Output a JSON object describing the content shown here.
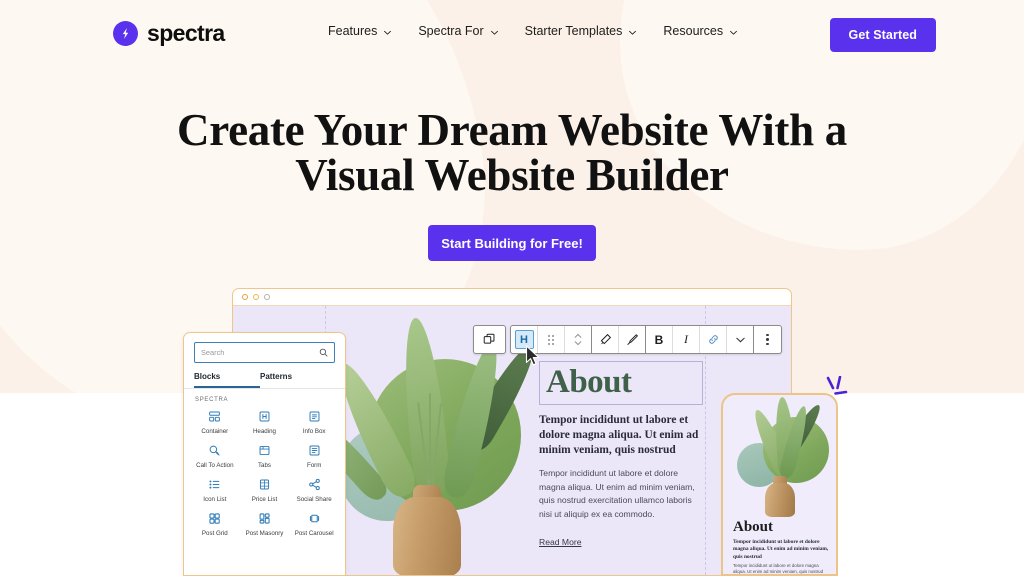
{
  "site": {
    "brand_name": "spectra",
    "brand_icon": "lightning-bolt-icon"
  },
  "header": {
    "nav_items": [
      {
        "label": "Features",
        "icon": "chevron-down-icon"
      },
      {
        "label": "Spectra For",
        "icon": "chevron-down-icon"
      },
      {
        "label": "Starter Templates",
        "icon": "chevron-down-icon"
      },
      {
        "label": "Resources",
        "icon": "chevron-down-icon"
      }
    ],
    "cta_label": "Get Started"
  },
  "hero": {
    "title_line1": "Create Your Dream Website With a",
    "title_line2": "Visual Website Builder",
    "cta_label": "Start Building for Free!"
  },
  "editor": {
    "inserter": {
      "search_placeholder": "Search",
      "search_icon": "search-icon",
      "tabs": [
        {
          "label": "Blocks",
          "active": true
        },
        {
          "label": "Patterns",
          "active": false
        }
      ],
      "section_label": "SPECTRA",
      "blocks": [
        {
          "label": "Container",
          "icon": "container-icon"
        },
        {
          "label": "Heading",
          "icon": "heading-icon"
        },
        {
          "label": "Info Box",
          "icon": "info-box-icon"
        },
        {
          "label": "Call To Action",
          "icon": "call-to-action-icon"
        },
        {
          "label": "Tabs",
          "icon": "tabs-icon"
        },
        {
          "label": "Form",
          "icon": "form-icon"
        },
        {
          "label": "Icon List",
          "icon": "icon-list-icon"
        },
        {
          "label": "Price List",
          "icon": "price-list-icon"
        },
        {
          "label": "Social Share",
          "icon": "social-share-icon"
        },
        {
          "label": "Post Grid",
          "icon": "post-grid-icon"
        },
        {
          "label": "Post Masonry",
          "icon": "post-masonry-icon"
        },
        {
          "label": "Post Carousel",
          "icon": "post-carousel-icon"
        }
      ]
    },
    "toolbar": {
      "copy_icon": "copy-blocks-icon",
      "block_type_label": "H",
      "drag_icon": "drag-handle-icon",
      "move_icon": "move-up-down-icon",
      "transform_icon": "transform-icon",
      "style_icon": "brush-icon",
      "bold_label": "B",
      "italic_label": "I",
      "link_icon": "link-icon",
      "more_formats_icon": "chevron-down-icon",
      "options_icon": "vertical-dots-icon"
    },
    "canvas": {
      "window_dots": [
        "close-dot",
        "minimize-dot",
        "maximize-dot"
      ],
      "heading": "About",
      "subheading": "Tempor incididunt ut labore et dolore magna aliqua. Ut enim ad minim veniam, quis nostrud",
      "paragraph": "Tempor incididunt ut labore et dolore magna aliqua. Ut enim ad minim veniam, quis nostrud exercitation ullamco laboris nisi ut aliquip ex ea commodo.",
      "link_label": "Read More"
    },
    "phone": {
      "heading": "About",
      "subheading": "Tempor incididunt ut labore et dolore magna aliqua. Ut enim ad minim veniam, quis nostrud",
      "paragraph": "Tempor incididunt ut labore et dolore magna aliqua. Ut enim ad minim veniam, quis nostrud exercitation ullamco laboris."
    }
  },
  "colors": {
    "brand_purple": "#5A32EE",
    "cream_bg": "#FBF1E8",
    "cream_blob": "#FDF8F1",
    "canvas_lavender": "#ECE7F8",
    "panel_border_gold": "#EFC58A",
    "heading_green": "#3F6049",
    "editor_blue": "#2E7CB8",
    "plant_green": "#7FA85C"
  }
}
